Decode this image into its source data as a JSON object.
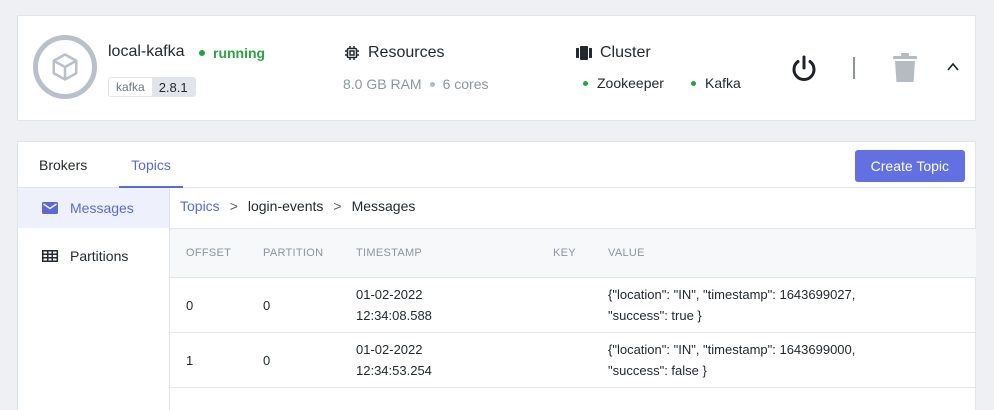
{
  "instance": {
    "name": "local-kafka",
    "status": "running",
    "tag_name": "kafka",
    "tag_version": "2.8.1",
    "resources": {
      "title": "Resources",
      "ram": "8.0 GB RAM",
      "cores": "6 cores"
    },
    "cluster": {
      "title": "Cluster",
      "services": [
        "Zookeeper",
        "Kafka"
      ]
    },
    "colors": {
      "running": "#2ea043",
      "accent": "#5b6ad1"
    }
  },
  "tabs": [
    "Brokers",
    "Topics"
  ],
  "active_tab": "Topics",
  "create_button": "Create Topic",
  "sidebar": {
    "items": [
      {
        "label": "Messages",
        "icon": "envelope-icon"
      },
      {
        "label": "Partitions",
        "icon": "table-grid-icon"
      }
    ]
  },
  "breadcrumb": [
    "Topics",
    "login-events",
    "Messages"
  ],
  "table": {
    "headers": [
      "OFFSET",
      "PARTITION",
      "TIMESTAMP",
      "KEY",
      "VALUE"
    ],
    "rows": [
      {
        "offset": "0",
        "partition": "0",
        "date": "01-02-2022",
        "time": "12:34:08.588",
        "key": "",
        "value_line1": "{\"location\": \"IN\", \"timestamp\": 1643699027,",
        "value_line2": "\"success\": true }"
      },
      {
        "offset": "1",
        "partition": "0",
        "date": "01-02-2022",
        "time": "12:34:53.254",
        "key": "",
        "value_line1": "{\"location\": \"IN\", \"timestamp\": 1643699000,",
        "value_line2": "\"success\": false }"
      }
    ]
  }
}
